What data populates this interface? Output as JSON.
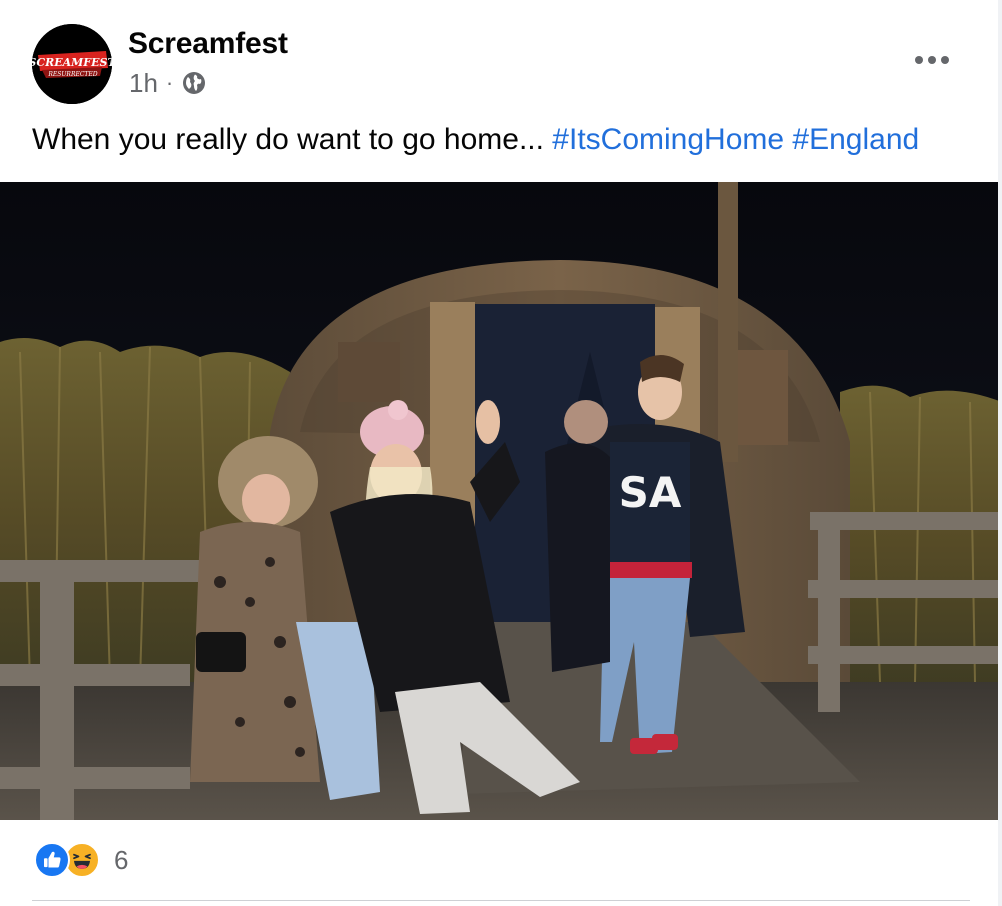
{
  "post": {
    "page_name": "Screamfest",
    "avatar_logo_text": "SCREAMFEST",
    "avatar_logo_subtext": "RESURRECTED",
    "time": "1h",
    "separator": "·",
    "privacy_icon": "globe-icon",
    "more_icon": "more-horizontal-icon",
    "text": "When you really do want to go home... ",
    "hashtags": [
      "#ItsComingHome",
      "#England"
    ]
  },
  "reactions": {
    "icons": [
      "like-icon",
      "haha-icon"
    ],
    "count": "6"
  },
  "colors": {
    "hashtag": "#216fdb",
    "secondary_text": "#65676b",
    "like_blue": "#1877f2",
    "haha_yellow": "#f7b125",
    "logo_red": "#d8231f"
  }
}
